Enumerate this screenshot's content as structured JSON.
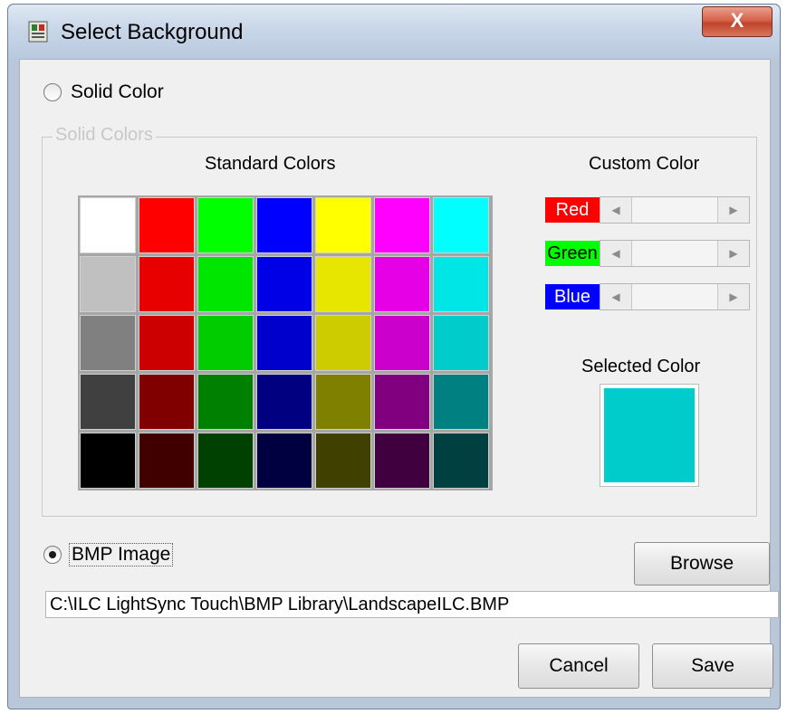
{
  "window": {
    "title": "Select Background",
    "close_glyph": "X",
    "app_icon": "app-icon"
  },
  "solid_color": {
    "label": "Solid Color",
    "checked": false
  },
  "group": {
    "legend": "Solid Colors"
  },
  "standard_colors": {
    "heading": "Standard Colors",
    "rows": [
      [
        "#ffffff",
        "#ff0000",
        "#00ff00",
        "#0000ff",
        "#ffff00",
        "#ff00ff",
        "#00ffff"
      ],
      [
        "#c0c0c0",
        "#e60000",
        "#00e600",
        "#0000e6",
        "#e6e600",
        "#e600e6",
        "#00e6e6"
      ],
      [
        "#808080",
        "#cc0000",
        "#00cc00",
        "#0000cc",
        "#cccc00",
        "#cc00cc",
        "#00cccc"
      ],
      [
        "#404040",
        "#800000",
        "#008000",
        "#000080",
        "#808000",
        "#800080",
        "#008080"
      ],
      [
        "#000000",
        "#400000",
        "#004000",
        "#000040",
        "#404000",
        "#400040",
        "#004040"
      ]
    ]
  },
  "custom_color": {
    "heading": "Custom Color",
    "channels": [
      {
        "label": "Red",
        "bg": "#ff0000",
        "color": "#ffffff"
      },
      {
        "label": "Green",
        "bg": "#00ff00",
        "color": "#000000"
      },
      {
        "label": "Blue",
        "bg": "#0000ff",
        "color": "#ffffff"
      }
    ]
  },
  "selected_color": {
    "label": "Selected Color",
    "value": "#00cccc"
  },
  "bmp_image": {
    "label": "BMP Image",
    "checked": true,
    "path": "C:\\ILC LightSync Touch\\BMP Library\\LandscapeILC.BMP"
  },
  "buttons": {
    "browse": "Browse",
    "cancel": "Cancel",
    "save": "Save"
  }
}
